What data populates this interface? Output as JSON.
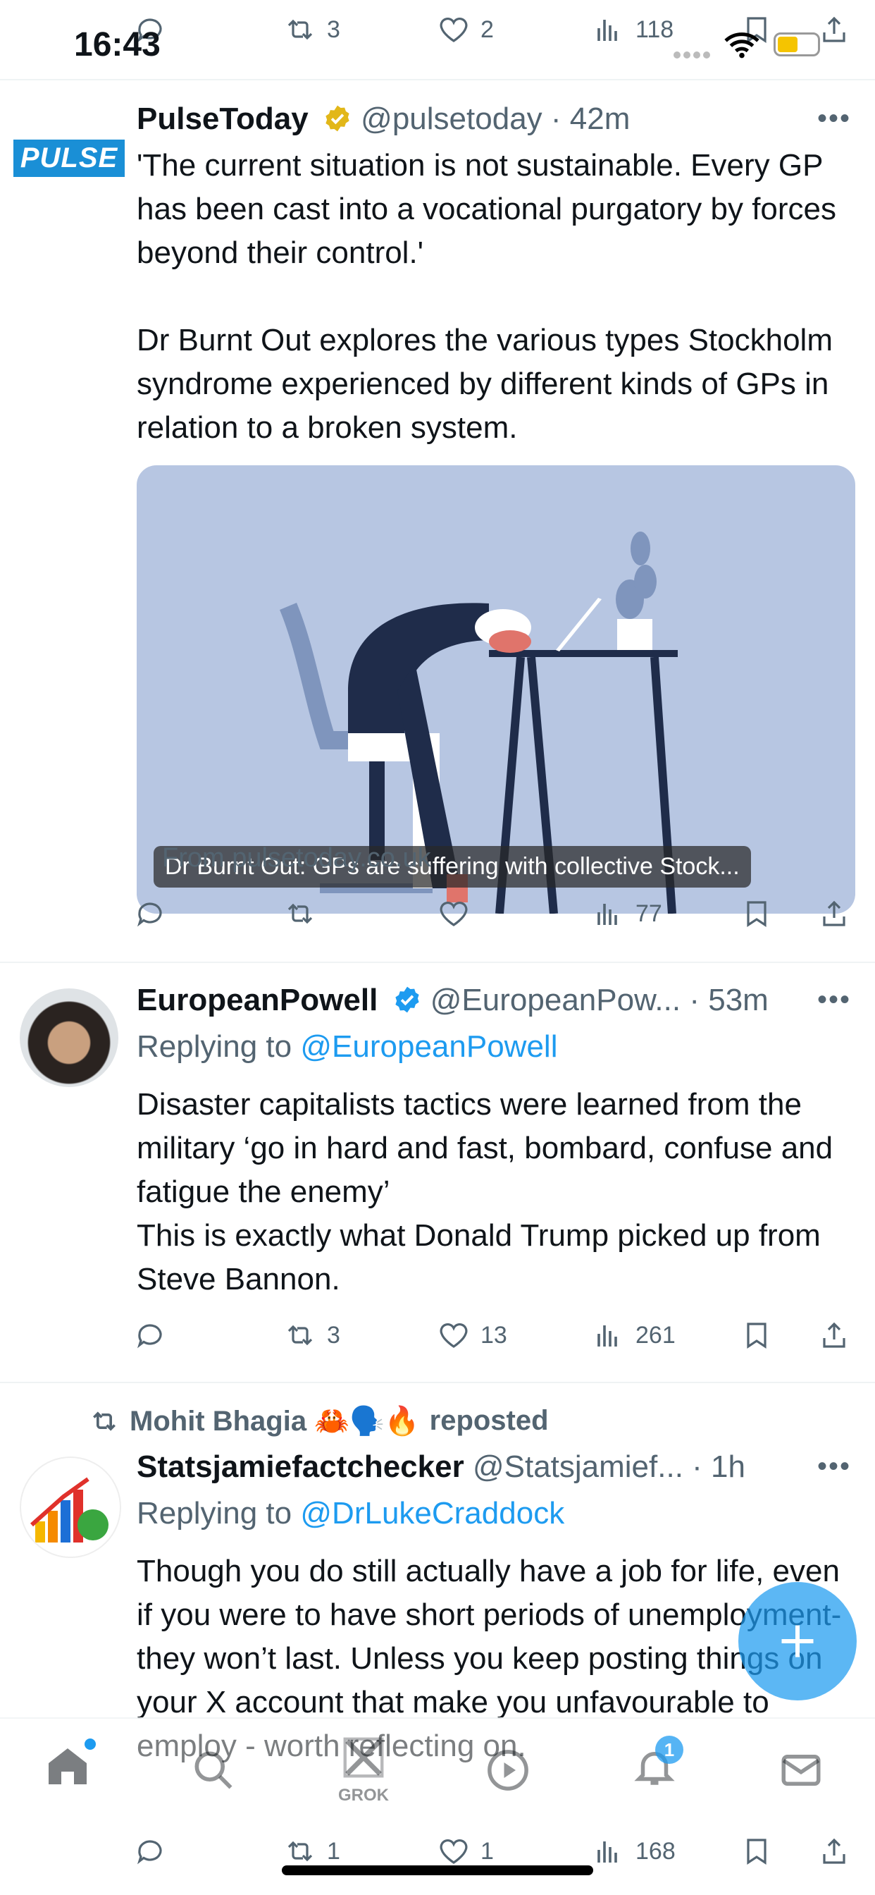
{
  "status_bar": {
    "time": "16:43"
  },
  "top_overlay_actions": {
    "retweets": "3",
    "likes": "2",
    "views": "118"
  },
  "tweets": [
    {
      "author": "PulseToday",
      "handle": "@pulsetoday",
      "time": "· 42m",
      "avatar_text": "PULSE",
      "text": "'The current situation is not sustainable. Every GP has been cast into a vocational purgatory by forces beyond their control.'\n\nDr Burnt Out explores the various types Stockholm syndrome experienced by different kinds of GPs in relation to a broken system.",
      "card": {
        "caption": "Dr Burnt Out: GPs are suffering with collective Stock...",
        "source": "From pulsetoday.co.uk"
      },
      "views": "77"
    },
    {
      "author": "EuropeanPowell",
      "handle": "@EuropeanPow...",
      "time": "· 53m",
      "reply_prefix": "Replying to",
      "reply_to": "@EuropeanPowell",
      "text": "Disaster capitalists tactics were learned from the military ‘go in hard and fast, bombard, confuse and fatigue the enemy’\nThis is exactly what Donald Trump picked up from Steve Bannon.",
      "retweets": "3",
      "likes": "13",
      "views": "261"
    },
    {
      "repost_by": "Mohit Bhagia 🦀🗣️🔥",
      "repost_label": "reposted",
      "author": "Statsjamiefactchecker",
      "handle": "@Statsjamief...",
      "time": "· 1h",
      "reply_prefix": "Replying to",
      "reply_to": "@DrLukeCraddock",
      "text": "Though you do still actually have a job for life, even if you were to have short periods of unemployment- they won’t last. Unless you keep posting things on your X account that make you unfavourable to employ - worth reflecting on.",
      "retweets": "1",
      "likes": "1",
      "views": "168"
    }
  ],
  "tab_bar": {
    "grok_label": "GROK",
    "notifications_badge": "1"
  },
  "colors": {
    "accent": "#1d9bf0",
    "verified_gold": "#e2b719",
    "muted": "#536471"
  }
}
